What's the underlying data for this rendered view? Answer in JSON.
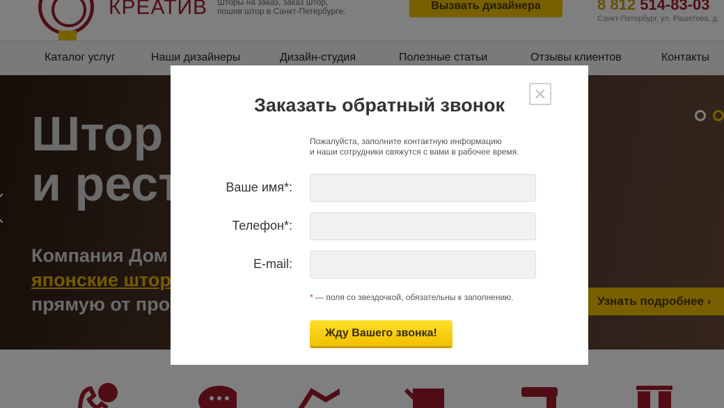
{
  "header": {
    "logo_text": "КРЕАТИВ",
    "tagline_line1": "Шторы на заказ, заказ штор,",
    "tagline_line2": "пошив штор в Санкт-Петербурге.",
    "call_designer": "Вызвать дизайнера",
    "phone_prefix": "8 812",
    "phone_number": "514-83-03",
    "address": "Санкт-Петербург, ул. Рашетова, д."
  },
  "nav": {
    "items": [
      "Каталог услуг",
      "Наши дизайнеры",
      "Дизайн-студия",
      "Полезные статьи",
      "Отзывы клиентов",
      "Контакты"
    ]
  },
  "hero": {
    "title_line1": "Штор",
    "title_line2": "и рест",
    "sub_line1": "Компания Дом",
    "sub_link": "японские штор",
    "sub_line3": "прямую от про",
    "more_button": "Узнать подробнее"
  },
  "modal": {
    "title": "Заказать обратный звонок",
    "desc_line1": "Пожалуйста, заполните контактную информацию",
    "desc_line2": "и наши сотрудники свяжутся с вами в рабочее время.",
    "fields": [
      {
        "label": "Ваше имя*:",
        "value": "",
        "placeholder": ""
      },
      {
        "label": "Телефон*:",
        "value": "",
        "placeholder": ""
      },
      {
        "label": "E-mail:",
        "value": "",
        "placeholder": ""
      }
    ],
    "required_star": "*",
    "required_note": " — поля со звездочкой, обязательны к заполнению.",
    "submit": "Жду Вашего звонка!"
  },
  "colors": {
    "accent_yellow": "#f0c000",
    "brand_red": "#a01a2a",
    "overlay": "rgba(0,0,0,0.5)"
  }
}
